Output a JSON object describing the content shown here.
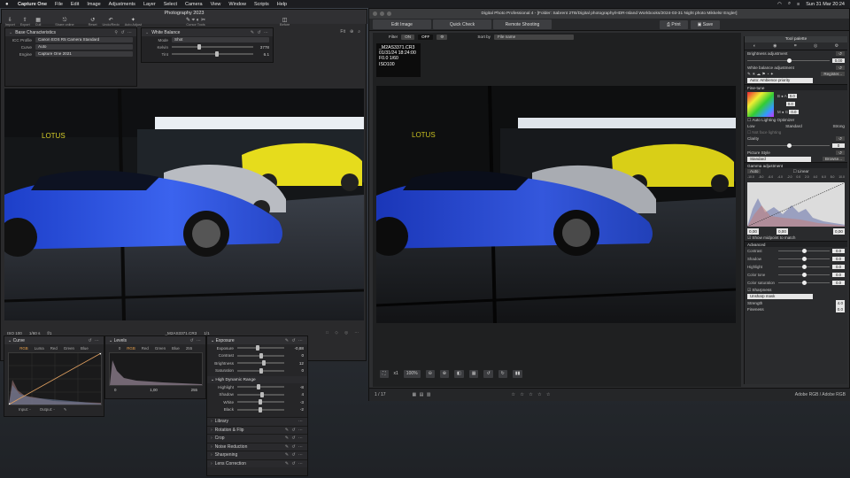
{
  "menubar": {
    "app": "Capture One",
    "items": [
      "File",
      "Edit",
      "Image",
      "Adjustments",
      "Layer",
      "Select",
      "Camera",
      "View",
      "Window",
      "Scripts",
      "Help"
    ],
    "clock": "Sun 31 Mar  20:24"
  },
  "c1": {
    "window_title": "Photography 2023",
    "toolbar": [
      {
        "icon": "import-icon",
        "label": "Import"
      },
      {
        "icon": "export-icon",
        "label": "Export"
      },
      {
        "icon": "cull-icon",
        "label": "Cull"
      },
      {
        "icon": "share-icon",
        "label": "Share online"
      },
      {
        "icon": "reset-icon",
        "label": "Reset"
      },
      {
        "icon": "undo-icon",
        "label": "Undo/Redo"
      },
      {
        "icon": "auto-adjust-icon",
        "label": "Auto Adjust"
      },
      {
        "icon": "cursor-tools-icon",
        "label": "Cursor Tools"
      },
      {
        "icon": "before-icon",
        "label": "Before"
      }
    ],
    "base_characteristics": {
      "title": "Base Characteristics",
      "rows": [
        {
          "k": "ICC Profile",
          "v": "Canon EOS R5 Camera Standard"
        },
        {
          "k": "Curve",
          "v": "Auto"
        },
        {
          "k": "Engine",
          "v": "Capture One 2021"
        }
      ]
    },
    "white_balance": {
      "title": "White Balance",
      "mode_label": "Mode",
      "mode_value": "Shot",
      "kelvin_label": "Kelvin",
      "kelvin_value": "3778",
      "kelvin_level": 0.34,
      "tint_label": "Tint",
      "tint_value": "6.1",
      "tint_level": 0.55
    },
    "viewer": {
      "fit_label": "Fit"
    },
    "status": {
      "iso": "ISO 100",
      "shutter": "1/60 s",
      "aperture": "f/1",
      "filename": "_M2AS3371.CR3",
      "extra": "1/1"
    },
    "curve": {
      "title": "Curve",
      "tabs": [
        "RGB",
        "Luma",
        "Red",
        "Green",
        "Blue"
      ],
      "active_tab": "RGB",
      "input_label": "Input:",
      "input_value": "-",
      "output_label": "Output:",
      "output_value": "-"
    },
    "levels": {
      "title": "Levels",
      "tabs": [
        "RGB",
        "Red",
        "Green",
        "Blue"
      ],
      "active_tab": "RGB",
      "low": "0",
      "high": "255",
      "foot_low": "0",
      "foot_mid": "1,00",
      "foot_high": "255"
    },
    "exposure": {
      "title": "Exposure",
      "rows": [
        {
          "k": "Exposure",
          "v": "-0,88",
          "level": 0.43
        },
        {
          "k": "Contrast",
          "v": "0",
          "level": 0.5
        },
        {
          "k": "Brightness",
          "v": "12",
          "level": 0.56
        },
        {
          "k": "Saturation",
          "v": "0",
          "level": 0.5
        }
      ]
    },
    "hdr": {
      "title": "High Dynamic Range",
      "rows": [
        {
          "k": "Highlight",
          "v": "-8",
          "level": 0.46
        },
        {
          "k": "Shadow",
          "v": "4",
          "level": 0.52
        },
        {
          "k": "White",
          "v": "-3",
          "level": 0.49
        },
        {
          "k": "Black",
          "v": "-2",
          "level": 0.49
        }
      ]
    },
    "collapsed_tools": [
      "Library",
      "Rotation & Flip",
      "Crop",
      "Noise Reduction",
      "Sharpening",
      "Lens Correction"
    ]
  },
  "dpp": {
    "title": "Digital Photo Professional 4 - [Folder: Sabrent 2TB/Digital photography/HDR-Island Workbooks/2024-03-31 Night photo Mikkelsr Engler]",
    "tabs": [
      "Edit Image",
      "Quick Check",
      "Remote Shooting"
    ],
    "print_label": "Print",
    "save_label": "Save",
    "filter_label": "Filter",
    "filter_on": "ON",
    "filter_off": "OFF",
    "sort_label": "Sort by",
    "sort_value": "File name",
    "info": {
      "file": "_M2AS3371.CR3",
      "datetime": "01/31/24 18:24:00",
      "exposure": "F0.0 1/60",
      "iso": "ISO100"
    },
    "zoom_label": "x1",
    "zoom_value": "100%",
    "footer_count": "1 / 17",
    "footer_right": "Adobe RGB / Adobe RGB",
    "palette": {
      "title": "Tool palette",
      "brightness_label": "Brightness adjustment",
      "brightness_value": "0.00",
      "brightness_level": 0.5,
      "wb_label": "White balance adjustment",
      "wb_select": "Auto: Ambience priority",
      "wb_register": "Register...",
      "finetune_label": "Fine-tune",
      "b_value": "0.0",
      "a_value": "0.0",
      "m_value": "0.0",
      "alo_label": "Auto Lighting Optimizer",
      "alo_low": "Low",
      "alo_standard": "Standard",
      "alo_strong": "Strong",
      "alo_disable": "Not face lighting",
      "clarity_label": "Clarity",
      "clarity_value": "0",
      "clarity_level": 0.5,
      "picstyle_label": "Picture Style",
      "picstyle_value": "Standard",
      "picstyle_browse": "Browse...",
      "gamma_label": "Gamma adjustment",
      "gamma_auto": "Auto",
      "gamma_linear": "Linear",
      "gamma_ticks": [
        "-10.0",
        "-8.0",
        "-6.0",
        "-4.0",
        "-2.0",
        "0.0",
        "2.0",
        "4.0",
        "6.0",
        "8.0",
        "10.0"
      ],
      "gamma_in_low": "0,00",
      "gamma_in_high": "0,00",
      "gamma_mid": "0,00",
      "gamma_checkbox": "Show midpoint to match",
      "advanced_label": "Advanced",
      "adv_rows": [
        {
          "k": "Contrast",
          "v": "0.0",
          "level": 0.5
        },
        {
          "k": "Shadow",
          "v": "0.0",
          "level": 0.5
        },
        {
          "k": "Highlight",
          "v": "0.0",
          "level": 0.5
        },
        {
          "k": "Color tone",
          "v": "0.0",
          "level": 0.5
        },
        {
          "k": "Color saturation",
          "v": "0.0",
          "level": 0.5
        }
      ],
      "sharpness_label": "Sharpness",
      "sharpness_select": "Unsharp mask",
      "strength_label": "Strength",
      "strength_value": "4.0",
      "fineness_label": "Fineness",
      "fineness_value": "0.0"
    }
  }
}
